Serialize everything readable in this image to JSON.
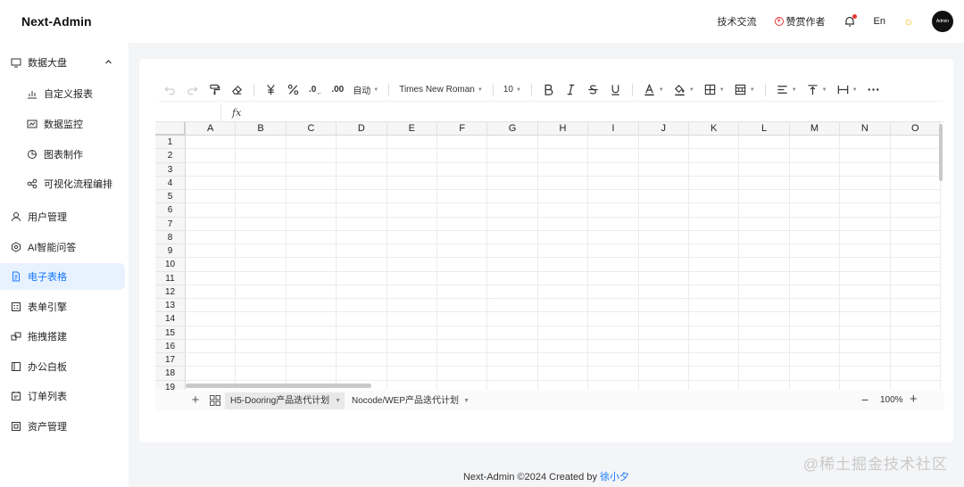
{
  "app": {
    "logo": "Next-Admin"
  },
  "header": {
    "tech_exchange": "技术交流",
    "sponsor": "赞赏作者",
    "sponsor_symbol": "¥",
    "lang": "En",
    "avatar_text": "Admin"
  },
  "sidebar": {
    "items": [
      {
        "label": "数据大盘",
        "icon": "monitor-icon"
      },
      {
        "label": "自定义报表",
        "icon": "bar-chart-icon"
      },
      {
        "label": "数据监控",
        "icon": "line-chart-icon"
      },
      {
        "label": "图表制作",
        "icon": "pie-chart-icon"
      },
      {
        "label": "可视化流程编排",
        "icon": "flow-icon"
      },
      {
        "label": "用户管理",
        "icon": "user-icon"
      },
      {
        "label": "AI智能问答",
        "icon": "ai-icon"
      },
      {
        "label": "电子表格",
        "icon": "sheet-file-icon"
      },
      {
        "label": "表单引擎",
        "icon": "form-icon"
      },
      {
        "label": "拖拽搭建",
        "icon": "drag-build-icon"
      },
      {
        "label": "办公白板",
        "icon": "whiteboard-icon"
      },
      {
        "label": "订单列表",
        "icon": "order-icon"
      },
      {
        "label": "资产管理",
        "icon": "asset-icon"
      }
    ]
  },
  "toolbar": {
    "font_format": "自动",
    "font_family": "Times New Roman",
    "font_size": "10",
    "decimal_decrease": ".0",
    "decimal_increase": ".00"
  },
  "formula": {
    "fx": "fx"
  },
  "grid": {
    "columns": [
      "A",
      "B",
      "C",
      "D",
      "E",
      "F",
      "G",
      "H",
      "I",
      "J",
      "K",
      "L",
      "M",
      "N",
      "O"
    ],
    "rows": [
      "1",
      "2",
      "3",
      "4",
      "5",
      "6",
      "7",
      "8",
      "9",
      "10",
      "11",
      "12",
      "13",
      "14",
      "15",
      "16",
      "17",
      "18",
      "19"
    ]
  },
  "sheets": {
    "tabs": [
      "H5-Dooring产品迭代计划",
      "Nocode/WEP产品迭代计划"
    ],
    "active": 0,
    "zoom": "100%"
  },
  "footer": {
    "text": "Next-Admin ©2024 Created by",
    "author": "徐小夕"
  },
  "watermark": "@稀土掘金技术社区",
  "colors": {
    "accent": "#1677ff",
    "active_bg": "#e8f2ff",
    "badge": "#e53935"
  }
}
